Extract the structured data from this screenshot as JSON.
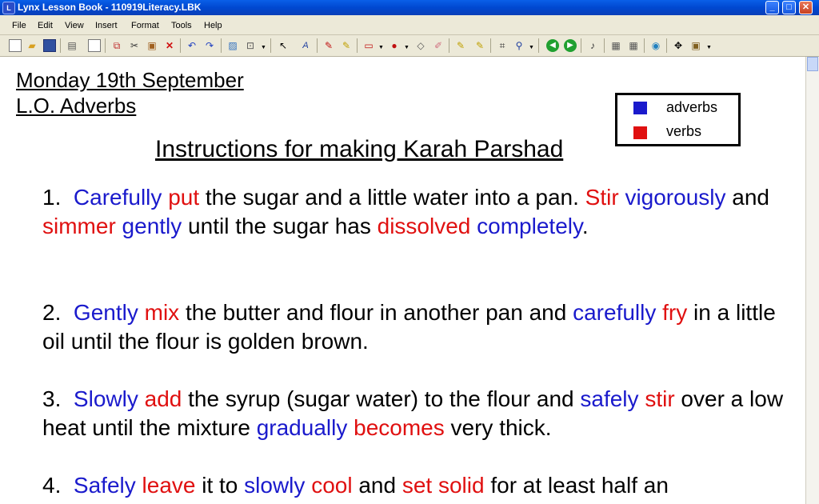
{
  "window": {
    "title": "Lynx Lesson Book - 110919Literacy.LBK",
    "icon": "lynx-app-icon",
    "controls": [
      "minimize",
      "maximize",
      "close"
    ]
  },
  "menu": [
    "File",
    "Edit",
    "View",
    "Insert",
    "Format",
    "Tools",
    "Help"
  ],
  "toolbar": {
    "buttons": [
      "new-icon",
      "open-icon",
      "save-icon",
      "print-icon",
      "page-icon",
      "copy-icon",
      "cut-icon",
      "paste-icon",
      "delete-icon",
      "undo-icon",
      "redo-icon",
      "image-icon",
      "zoom-icon",
      "select-arrow-icon",
      "text-style-icon",
      "pen-icon",
      "highlighter-icon",
      "shape-icon",
      "fill-icon",
      "eraser-icon",
      "pencil-icon",
      "marker-icon",
      "crop-icon",
      "link-icon",
      "back-icon",
      "forward-icon",
      "audio-icon",
      "keyboard-icon",
      "calculator-icon",
      "globe-icon",
      "move-icon",
      "settings-icon"
    ]
  },
  "colors": {
    "adverb": "#1a1acc",
    "verb": "#e01010",
    "titlebar": "#0a4fe0"
  },
  "document": {
    "date": "Monday 19th September",
    "lo": "L.O. Adverbs",
    "heading": "Instructions for making Karah Parshad",
    "legend": [
      {
        "label": "adverbs",
        "color": "#1a1acc"
      },
      {
        "label": "verbs",
        "color": "#e01010"
      }
    ],
    "paragraphs": [
      {
        "number": "1.",
        "segments": [
          {
            "text": "Carefully",
            "type": "adverb"
          },
          {
            "text": " ",
            "type": "plain"
          },
          {
            "text": "put",
            "type": "verb"
          },
          {
            "text": " the sugar and a little water into a pan.  ",
            "type": "plain"
          },
          {
            "text": "Stir",
            "type": "verb"
          },
          {
            "text": " ",
            "type": "plain"
          },
          {
            "text": "vigorously",
            "type": "adverb"
          },
          {
            "text": " and ",
            "type": "plain"
          },
          {
            "text": "simmer",
            "type": "verb"
          },
          {
            "text": " ",
            "type": "plain"
          },
          {
            "text": "gently",
            "type": "adverb"
          },
          {
            "text": " until the sugar has ",
            "type": "plain"
          },
          {
            "text": "dissolved",
            "type": "verb"
          },
          {
            "text": " ",
            "type": "plain"
          },
          {
            "text": "completely",
            "type": "adverb"
          },
          {
            "text": ".",
            "type": "plain"
          }
        ]
      },
      {
        "number": "2.",
        "segments": [
          {
            "text": "Gently",
            "type": "adverb"
          },
          {
            "text": " ",
            "type": "plain"
          },
          {
            "text": "mix",
            "type": "verb"
          },
          {
            "text": " the butter and flour in another pan and ",
            "type": "plain"
          },
          {
            "text": "carefully",
            "type": "adverb"
          },
          {
            "text": " ",
            "type": "plain"
          },
          {
            "text": "fry",
            "type": "verb"
          },
          {
            "text": " in a little oil until the flour is golden brown.",
            "type": "plain"
          }
        ]
      },
      {
        "number": "3.",
        "segments": [
          {
            "text": "Slowly",
            "type": "adverb"
          },
          {
            "text": " ",
            "type": "plain"
          },
          {
            "text": "add",
            "type": "verb"
          },
          {
            "text": " the syrup (sugar water) to the flour and ",
            "type": "plain"
          },
          {
            "text": "safely",
            "type": "adverb"
          },
          {
            "text": " ",
            "type": "plain"
          },
          {
            "text": "stir",
            "type": "verb"
          },
          {
            "text": " over a low heat until the mixture ",
            "type": "plain"
          },
          {
            "text": "gradually",
            "type": "adverb"
          },
          {
            "text": " ",
            "type": "plain"
          },
          {
            "text": "becomes",
            "type": "verb"
          },
          {
            "text": " very thick.",
            "type": "plain"
          }
        ]
      },
      {
        "number": "4.",
        "segments": [
          {
            "text": "Safely",
            "type": "adverb"
          },
          {
            "text": " ",
            "type": "plain"
          },
          {
            "text": "leave",
            "type": "verb"
          },
          {
            "text": " it to ",
            "type": "plain"
          },
          {
            "text": "slowly",
            "type": "adverb"
          },
          {
            "text": " ",
            "type": "plain"
          },
          {
            "text": "cool",
            "type": "verb"
          },
          {
            "text": " and ",
            "type": "plain"
          },
          {
            "text": "set solid",
            "type": "verb"
          },
          {
            "text": " for at least half an",
            "type": "plain"
          }
        ]
      }
    ]
  }
}
